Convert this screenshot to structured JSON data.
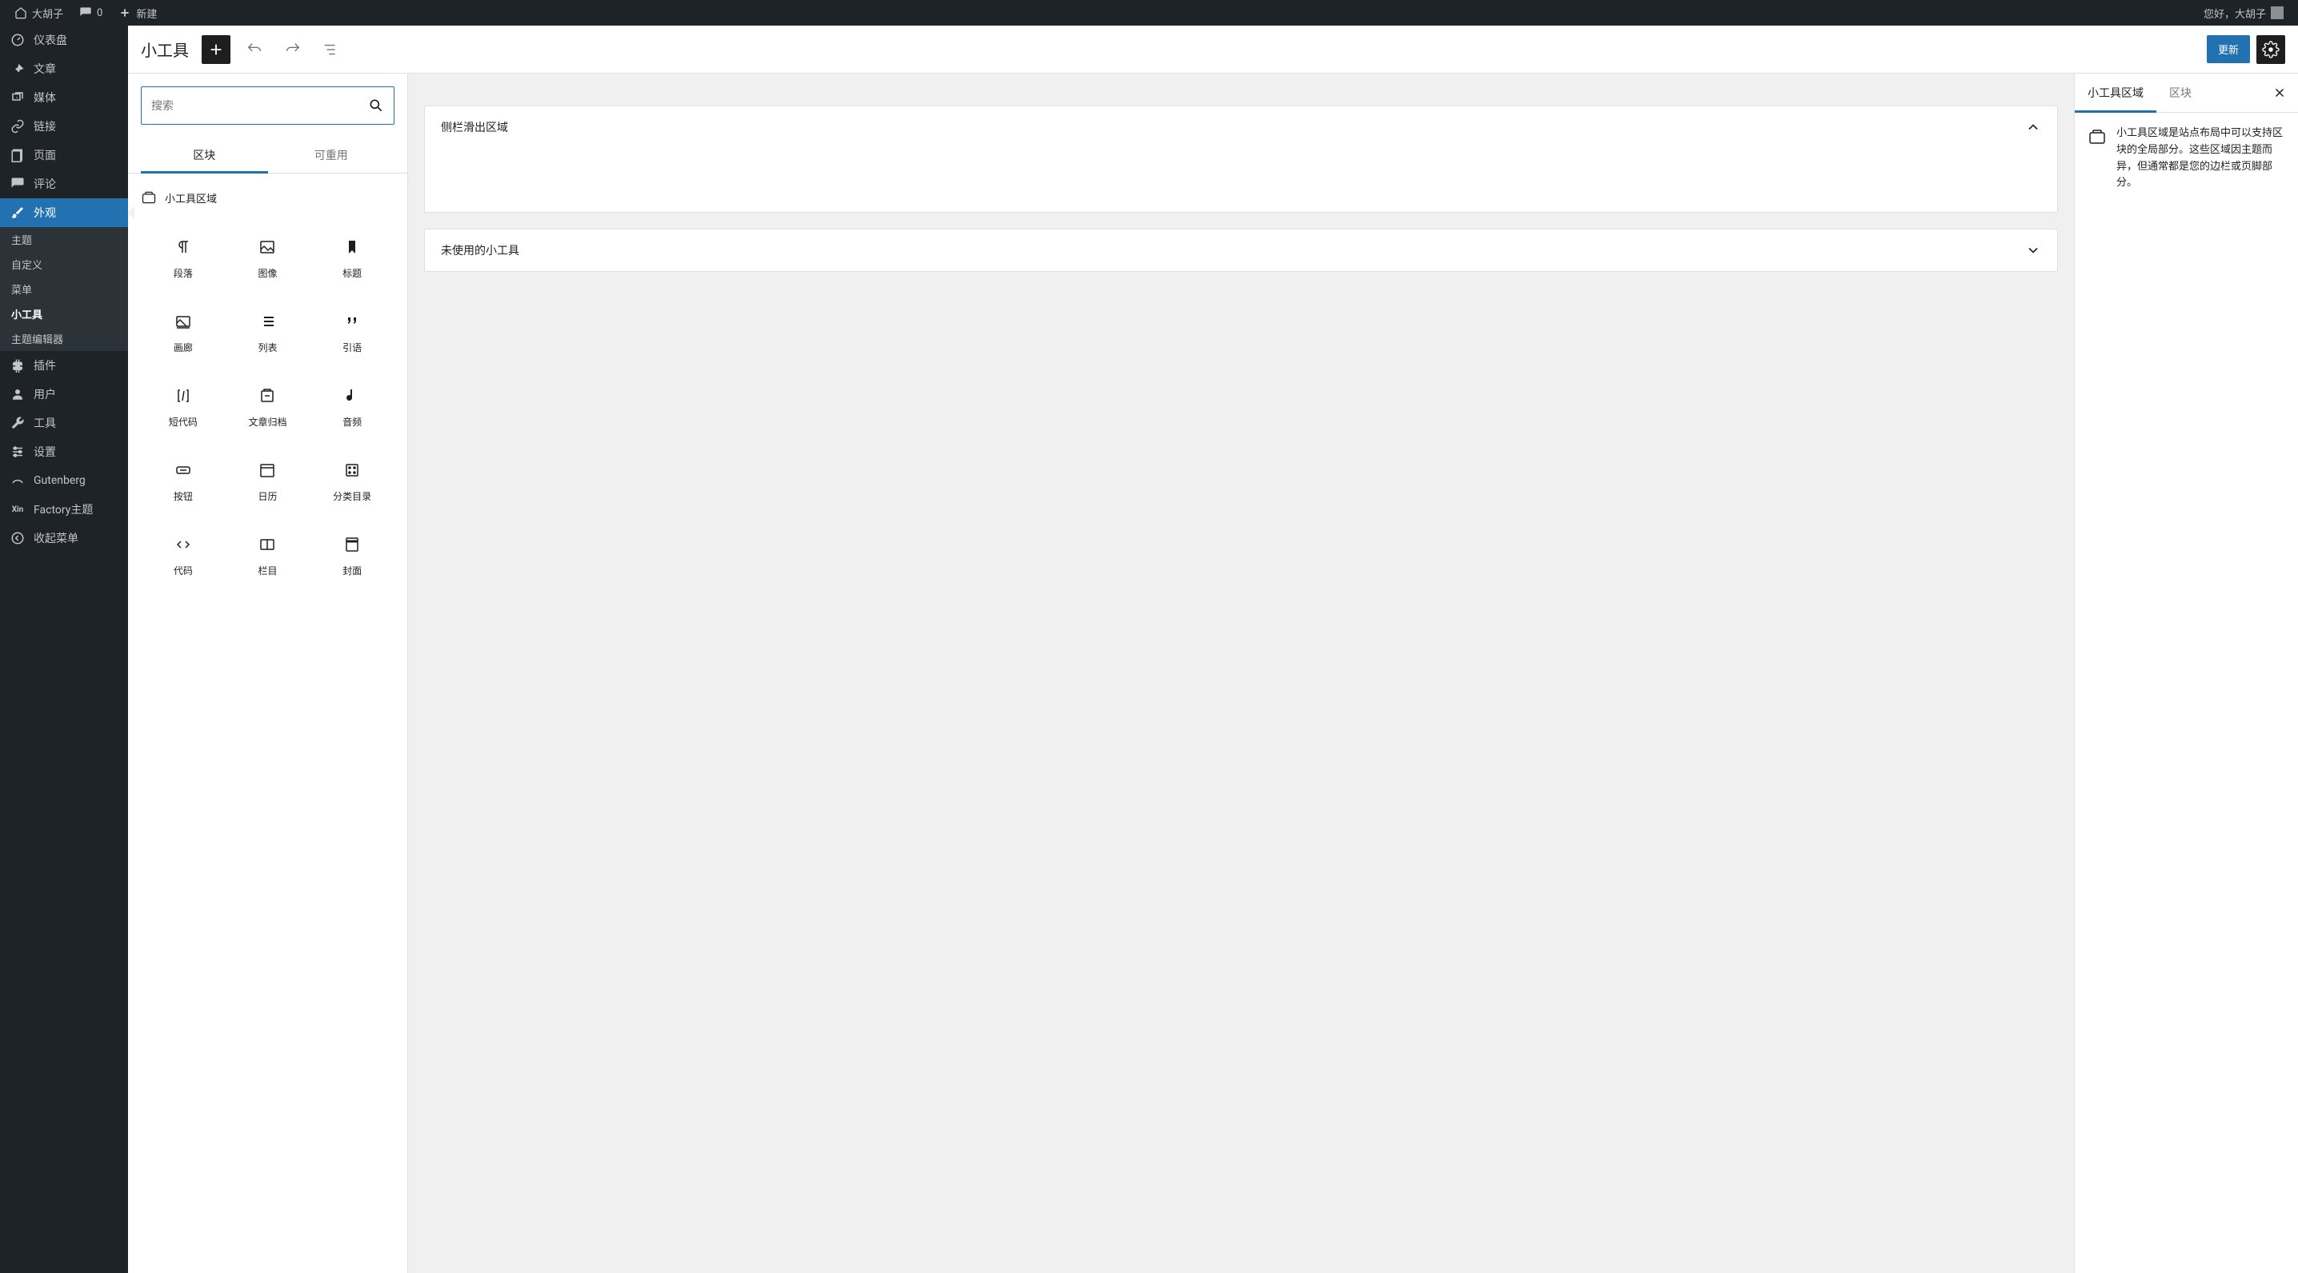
{
  "adminBar": {
    "siteName": "大胡子",
    "commentsCount": "0",
    "newLabel": "新建",
    "greeting": "您好，大胡子"
  },
  "sidebar": {
    "dashboard": "仪表盘",
    "posts": "文章",
    "media": "媒体",
    "links": "链接",
    "pages": "页面",
    "comments": "评论",
    "appearance": "外观",
    "appearanceSub": {
      "themes": "主题",
      "customize": "自定义",
      "menus": "菜单",
      "widgets": "小工具",
      "themeEditor": "主题编辑器"
    },
    "plugins": "插件",
    "users": "用户",
    "tools": "工具",
    "settings": "设置",
    "gutenberg": "Gutenberg",
    "factory": "Factory主题",
    "collapse": "收起菜单"
  },
  "header": {
    "title": "小工具",
    "updateBtn": "更新"
  },
  "inserter": {
    "searchPlaceholder": "搜索",
    "tabBlocks": "区块",
    "tabReusable": "可重用",
    "groupTitle": "小工具区域",
    "blocks": {
      "paragraph": "段落",
      "image": "图像",
      "heading": "标题",
      "gallery": "画廊",
      "list": "列表",
      "quote": "引语",
      "shortcode": "短代码",
      "archives": "文章归档",
      "audio": "音频",
      "button": "按钮",
      "calendar": "日历",
      "categories": "分类目录",
      "code": "代码",
      "columns": "栏目",
      "cover": "封面"
    }
  },
  "canvas": {
    "area1": "侧栏滑出区域",
    "area2": "未使用的小工具"
  },
  "settings": {
    "tabAreas": "小工具区域",
    "tabBlock": "区块",
    "description": "小工具区域是站点布局中可以支持区块的全局部分。这些区域因主题而异，但通常都是您的边栏或页脚部分。"
  }
}
